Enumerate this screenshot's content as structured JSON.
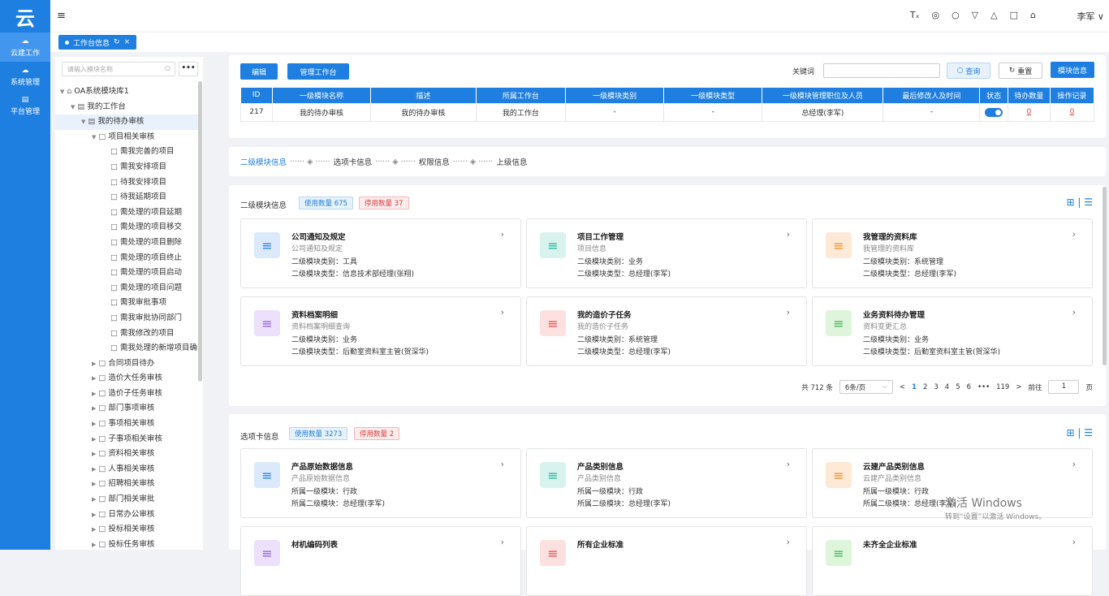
{
  "sidebar": {
    "logo": "云",
    "items": [
      {
        "label": "云建工作",
        "icon": "cloud-icon"
      },
      {
        "label": "系统管理",
        "icon": "cloud-icon"
      },
      {
        "label": "平台管理",
        "icon": "grid-icon"
      }
    ]
  },
  "header": {
    "menu_icon": "≡",
    "icons": [
      "Tₓ",
      "◎",
      "○",
      "▽",
      "△",
      "□",
      "⌂"
    ],
    "user": "李军 ∨"
  },
  "tabs": {
    "active_label": "工作台信息",
    "refresh": "↻",
    "close": "×"
  },
  "tree": {
    "search_placeholder": "请输入模块名称",
    "more": "•••",
    "nodes": [
      {
        "label": "OA系统模块库1",
        "level": 0,
        "arrow": "▼"
      },
      {
        "label": "我的工作台",
        "level": 1,
        "arrow": "▼"
      },
      {
        "label": "我的待办审核",
        "level": 2,
        "arrow": "▼",
        "selected": true
      },
      {
        "label": "项目相关审核",
        "level": 3,
        "arrow": "▼"
      },
      {
        "label": "需我完善的项目",
        "level": 4
      },
      {
        "label": "需我安排项目",
        "level": 4
      },
      {
        "label": "待我安排项目",
        "level": 4
      },
      {
        "label": "待我延期项目",
        "level": 4
      },
      {
        "label": "需处理的项目延期",
        "level": 4
      },
      {
        "label": "需处理的项目移交",
        "level": 4
      },
      {
        "label": "需处理的项目删除",
        "level": 4
      },
      {
        "label": "需处理的项目终止",
        "level": 4
      },
      {
        "label": "需处理的项目启动",
        "level": 4
      },
      {
        "label": "需处理的项目问题",
        "level": 4
      },
      {
        "label": "需我审批事项",
        "level": 4
      },
      {
        "label": "需我审批协同部门",
        "level": 4
      },
      {
        "label": "需我修改的项目",
        "level": 4
      },
      {
        "label": "需我处理的新增项目确",
        "level": 4
      },
      {
        "label": "合同项目待办",
        "level": 3,
        "arrow": "▶"
      },
      {
        "label": "造价大任务审核",
        "level": 3,
        "arrow": "▶"
      },
      {
        "label": "造价子任务审核",
        "level": 3,
        "arrow": "▶"
      },
      {
        "label": "部门事项审核",
        "level": 3,
        "arrow": "▶"
      },
      {
        "label": "事项相关审核",
        "level": 3,
        "arrow": "▶"
      },
      {
        "label": "子事项相关审核",
        "level": 3,
        "arrow": "▶"
      },
      {
        "label": "资料相关审核",
        "level": 3,
        "arrow": "▶"
      },
      {
        "label": "人事相关审核",
        "level": 3,
        "arrow": "▶"
      },
      {
        "label": "招聘相关审核",
        "level": 3,
        "arrow": "▶"
      },
      {
        "label": "部门相关审批",
        "level": 3,
        "arrow": "▶"
      },
      {
        "label": "日常办公审核",
        "level": 3,
        "arrow": "▶"
      },
      {
        "label": "投标相关审核",
        "level": 3,
        "arrow": "▶"
      },
      {
        "label": "投标任务审核",
        "level": 3,
        "arrow": "▶"
      }
    ]
  },
  "toolbar": {
    "edit": "编辑",
    "manage": "管理工作台",
    "keyword_label": "关键词",
    "query": "查询",
    "reset": "重置",
    "module_info": "模块信息"
  },
  "table": {
    "headers": [
      "ID",
      "一级模块名称",
      "描述",
      "所属工作台",
      "一级模块类别",
      "一级模块类型",
      "一级模块管理职位及人员",
      "最后修改人及时间",
      "状态",
      "待办数量",
      "操作记录"
    ],
    "row": [
      "217",
      "我的待办审核",
      "我的待办审核",
      "我的工作台",
      "-",
      "-",
      "总经理(李军)",
      "-",
      "",
      "0",
      "0"
    ]
  },
  "steps": [
    "二级模块信息",
    "选项卡信息",
    "权限信息",
    "上级信息"
  ],
  "section1": {
    "title": "二级模块信息",
    "used": "使用数量 675",
    "disabled": "停用数量 37",
    "cards": [
      {
        "title": "公司通知及规定",
        "sub": "公司通知及规定",
        "l1": "二级模块类别：工具",
        "l2": "二级模块类型：信息技术部经理(张翔)",
        "color": "#dbe9fb",
        "fg": "#1e7fe0"
      },
      {
        "title": "项目工作管理",
        "sub": "项目信息",
        "l1": "二级模块类别：业务",
        "l2": "二级模块类型：总经理(李军)",
        "color": "#d8f3ee",
        "fg": "#1ab394"
      },
      {
        "title": "我管理的资料库",
        "sub": "我管理的资料库",
        "l1": "二级模块类别：系统管理",
        "l2": "二级模块类型：总经理(李军)",
        "color": "#fde9d6",
        "fg": "#f08a24"
      },
      {
        "title": "资料档案明细",
        "sub": "资料档案明细查询",
        "l1": "二级模块类别：业务",
        "l2": "二级模块类型：后勤室资料室主管(贺深华)",
        "color": "#ece0fb",
        "fg": "#8e5bd8"
      },
      {
        "title": "我的造价子任务",
        "sub": "我的造价子任务",
        "l1": "二级模块类别：系统管理",
        "l2": "二级模块类型：总经理(李军)",
        "color": "#fde0e0",
        "fg": "#e04848"
      },
      {
        "title": "业务资料待办管理",
        "sub": "资料变更汇总",
        "l1": "二级模块类别：业务",
        "l2": "二级模块类型：后勤室资料室主管(贺深华)",
        "color": "#def5dc",
        "fg": "#3cb34a"
      }
    ]
  },
  "pager": {
    "total": "共 712 条",
    "size": "6条/页",
    "prev": "<",
    "pages": [
      "1",
      "2",
      "3",
      "4",
      "5",
      "6",
      "•••",
      "119"
    ],
    "next": ">",
    "goto": "前往",
    "page": "1",
    "page_unit": "页"
  },
  "section2": {
    "title": "选项卡信息",
    "used": "使用数量 3273",
    "disabled": "停用数量 2",
    "cards": [
      {
        "title": "产品原始数据信息",
        "sub": "产品原始数据信息",
        "l1": "所属一级模块：行政",
        "l2": "所属二级模块：总经理(李军)",
        "color": "#dbe9fb",
        "fg": "#1e7fe0"
      },
      {
        "title": "产品类别信息",
        "sub": "产品类别信息",
        "l1": "所属一级模块：行政",
        "l2": "所属二级模块：总经理(李军)",
        "color": "#d8f3ee",
        "fg": "#1ab394"
      },
      {
        "title": "云建产品类别信息",
        "sub": "云建产品类别信息",
        "l1": "所属一级模块：行政",
        "l2": "所属二级模块：总经理(李军)",
        "color": "#fde9d6",
        "fg": "#f08a24"
      },
      {
        "title": "材机编码列表",
        "sub": "",
        "l1": "",
        "l2": "",
        "color": "#ece0fb",
        "fg": "#8e5bd8"
      },
      {
        "title": "所有企业标准",
        "sub": "",
        "l1": "",
        "l2": "",
        "color": "#fde0e0",
        "fg": "#e04848"
      },
      {
        "title": "未齐全企业标准",
        "sub": "",
        "l1": "",
        "l2": "",
        "color": "#def5dc",
        "fg": "#3cb34a"
      }
    ]
  },
  "watermark": {
    "line1": "激活 Windows",
    "line2": "转到“设置”以激活 Windows。"
  }
}
